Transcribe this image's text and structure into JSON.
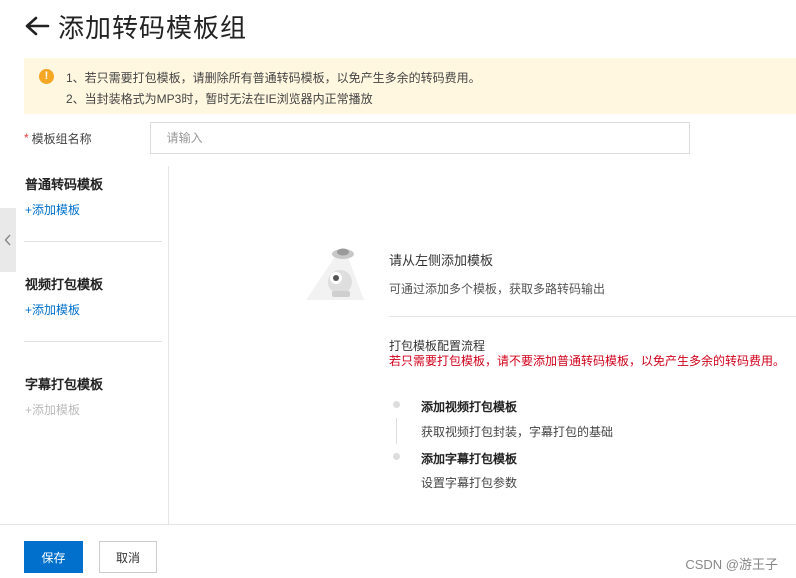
{
  "header": {
    "title": "添加转码模板组"
  },
  "notice": {
    "line1": "1、若只需要打包模板，请删除所有普通转码模板，以免产生多余的转码费用。",
    "line2": "2、当封装格式为MP3时，暂时无法在IE浏览器内正常播放"
  },
  "form": {
    "required_mark": "*",
    "name_label": "模板组名称",
    "name_value": "",
    "name_placeholder": "请输入"
  },
  "sidebar": {
    "sections": [
      {
        "title": "普通转码模板",
        "add_label": "+添加模板"
      },
      {
        "title": "视频打包模板",
        "add_label": "+添加模板"
      },
      {
        "title": "字幕打包模板",
        "add_label": "+添加模板"
      }
    ]
  },
  "empty_state": {
    "title": "请从左侧添加模板",
    "subtitle": "可通过添加多个模板，获取多路转码输出"
  },
  "flow": {
    "title": "打包模板配置流程",
    "warning": "若只需要打包模板，请不要添加普通转码模板，以免产生多余的转码费用。",
    "steps": [
      {
        "title": "添加视频打包模板",
        "desc": "获取视频打包封装，字幕打包的基础"
      },
      {
        "title": "添加字幕打包模板",
        "desc": "设置字幕打包参数"
      }
    ]
  },
  "footer": {
    "save_label": "保存",
    "cancel_label": "取消"
  },
  "watermark": "CSDN @游王子",
  "colors": {
    "primary": "#0070cc",
    "warning_bg": "#fff7e0",
    "warning_icon": "#f5a623",
    "danger_text": "#d0021b"
  },
  "icons": {
    "back": "arrow-left-icon",
    "notice": "warning-circle-icon",
    "collapse": "chevron-left-icon",
    "empty": "empty-ufo-illustration"
  }
}
